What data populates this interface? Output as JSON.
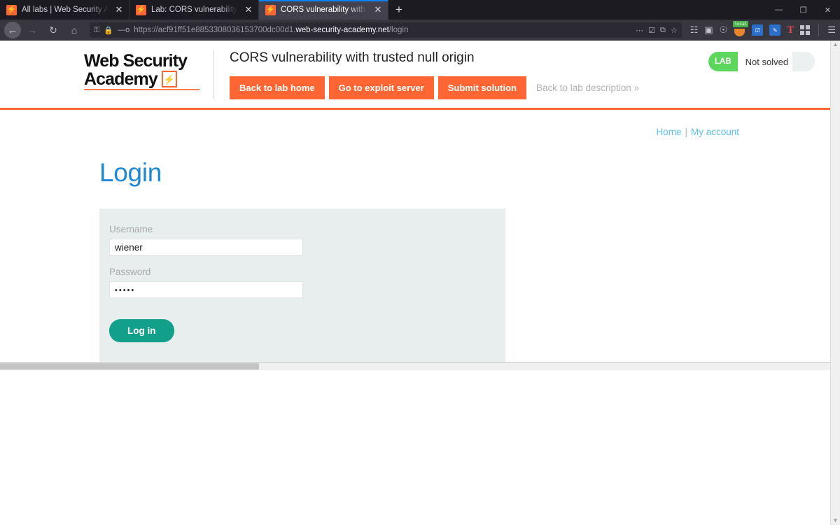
{
  "browser": {
    "tabs": [
      {
        "title": "All labs | Web Security Academy",
        "favicon": "burp-icon",
        "active": false
      },
      {
        "title": "Lab: CORS vulnerability with tru",
        "favicon": "burp-icon",
        "active": false
      },
      {
        "title": "CORS vulnerability with trusted",
        "favicon": "burp-icon",
        "active": true
      }
    ],
    "new_tab_label": "+",
    "window_controls": {
      "minimize": "—",
      "maximize": "❐",
      "close": "✕"
    },
    "nav": {
      "back": "←",
      "forward": "→",
      "reload": "↻",
      "home": "⌂"
    },
    "url": {
      "prefix": "https://acf91ff51e8853308036153700dc00d1.",
      "domain": "web-security-academy.net",
      "path": "/login",
      "shield_icon": "shield-icon",
      "lock_icon": "lock-icon",
      "permission_icon": "permissions-icon"
    },
    "url_actions": {
      "more": "⋯",
      "reader": "☑",
      "translate": "⧉",
      "bookmark": "☆"
    },
    "toolbar_icons": {
      "library": "library-icon",
      "sidebar": "sidebar-icon",
      "account": "account-icon",
      "local_badge": "local",
      "text_ext": "T",
      "extensions": "extensions-grid-icon",
      "app_menu": "☰"
    }
  },
  "lab_header": {
    "logo_line1": "Web Security",
    "logo_line2": "Academy",
    "title": "CORS vulnerability with trusted null origin",
    "buttons": [
      {
        "label": "Back to lab home"
      },
      {
        "label": "Go to exploit server"
      },
      {
        "label": "Submit solution"
      }
    ],
    "description_link": "Back to lab description »",
    "status": {
      "badge": "LAB",
      "state": "Not solved"
    }
  },
  "page": {
    "topnav": {
      "home": "Home",
      "separator": "|",
      "my_account": "My account"
    },
    "heading": "Login",
    "form": {
      "username_label": "Username",
      "username_value": "wiener",
      "password_label": "Password",
      "password_value": "•••••",
      "submit_label": "Log in"
    }
  },
  "colors": {
    "brand_orange": "#ff6633",
    "heading_blue": "#1e87d6",
    "login_button_teal": "#12a08a",
    "lab_badge_green": "#5cd65c",
    "link_blue": "#5bc0f0",
    "panel_bg": "#e8edee"
  }
}
